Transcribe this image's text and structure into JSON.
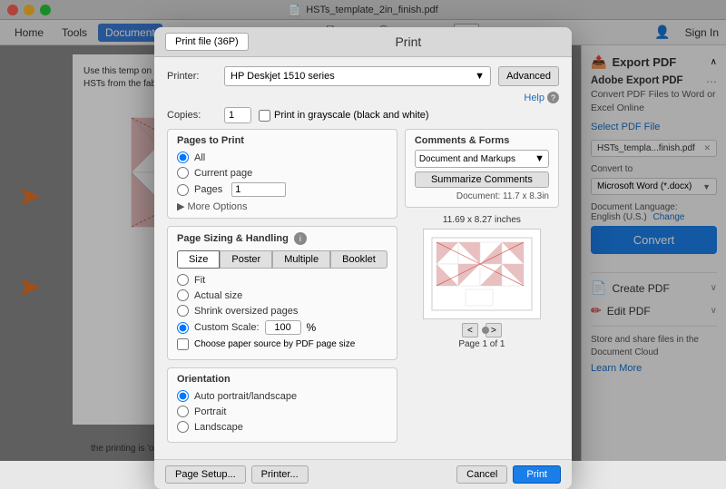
{
  "titleBar": {
    "title": "HSTs_template_2in_finish.pdf",
    "buttons": [
      "close",
      "minimize",
      "maximize"
    ]
  },
  "menuBar": {
    "items": [
      "Home",
      "Tools",
      "Document"
    ],
    "activeItem": "Document",
    "toolbar": {
      "printIcon": "🖨",
      "emailIcon": "✉",
      "searchIcon": "🔍",
      "backIcon": "◀",
      "forwardIcon": "▶",
      "pageInput": "1",
      "pageTotal": "1",
      "signIn": "Sign In"
    }
  },
  "printDialog": {
    "title": "Print",
    "tab": "Print file (36P)",
    "printer": {
      "label": "Printer:",
      "value": "HP Deskjet 1510 series",
      "advancedBtn": "Advanced",
      "helpLabel": "Help"
    },
    "copies": {
      "label": "Copies:",
      "value": "1",
      "grayscaleLabel": "Print in grayscale (black and white)"
    },
    "pagesToPrint": {
      "title": "Pages to Print",
      "options": [
        "All",
        "Current page",
        "Pages"
      ],
      "pagesValue": "1",
      "moreOptions": "More Options"
    },
    "pageSizing": {
      "title": "Page Sizing & Handling",
      "buttons": [
        "Size",
        "Poster",
        "Multiple",
        "Booklet"
      ],
      "activeBtn": "Size",
      "radios": [
        "Fit",
        "Actual size",
        "Shrink oversized pages",
        "Custom Scale:"
      ],
      "activeRadio": "Custom Scale:",
      "scaleValue": "100",
      "scaleUnit": "%",
      "chooseByPDF": "Choose paper source by PDF page size"
    },
    "orientation": {
      "title": "Orientation",
      "options": [
        "Auto portrait/landscape",
        "Portrait",
        "Landscape"
      ],
      "activeOption": "Auto portrait/landscape"
    },
    "commentsAndForms": {
      "title": "Comments & Forms",
      "selectValue": "Document and Markups",
      "summarizeBtn": "Summarize Comments",
      "docSize": "Document: 11.7 x 8.3in"
    },
    "preview": {
      "label": "11.69 x 8.27 inches",
      "page": "Page 1 of 1"
    },
    "footer": {
      "pageSetupBtn": "Page Setup...",
      "printerBtn": "Printer...",
      "cancelBtn": "Cancel",
      "printBtn": "Print"
    }
  },
  "rightPanel": {
    "exportPDF": {
      "title": "Export PDF",
      "collapseIcon": "∧"
    },
    "adobeExportTitle": "Adobe Export PDF",
    "adobeExportSubtitle": "Convert PDF Files to Word or Excel Online",
    "selectPDFLink": "Select PDF File",
    "fileInputValue": "HSTs_templa...finish.pdf",
    "convertToLabel": "Convert to",
    "convertToValue": "Microsoft Word (*.docx)",
    "docLanguageLabel": "Document Language:",
    "docLanguageValue": "English (U.S.)",
    "changeLink": "Change",
    "convertBtn": "Convert",
    "createPDF": {
      "label": "Create PDF",
      "icon": "📄"
    },
    "editPDF": {
      "label": "Edit PDF",
      "icon": "✏"
    },
    "storeText": "Store and share files in the Document Cloud",
    "learnMoreLink": "Learn More"
  },
  "pdfContent": {
    "instructionText": "Use this template on HSTs from the fabric...",
    "arrowAnnotation1": "→",
    "arrowAnnotation2": "→",
    "bottomNote": "the printing is 'on' but that the 'fit to page' option is not ticked."
  }
}
